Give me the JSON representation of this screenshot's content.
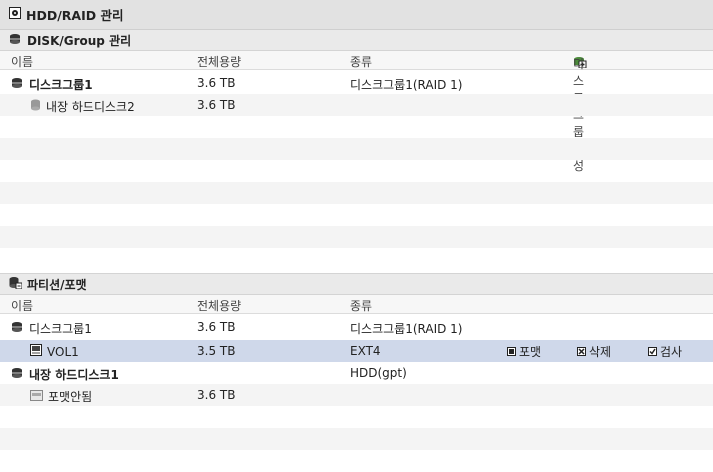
{
  "header": {
    "title": "HDD/RAID 관리"
  },
  "disk_section": {
    "title": "DISK/Group 관리",
    "columns": {
      "name": "이름",
      "total": "전체용량",
      "type": "종류"
    },
    "create_label": "디스크그룹 생성",
    "rows": [
      {
        "name": "디스크그룹1",
        "size": "3.6 TB",
        "type": "디스크그룹1(RAID 1)"
      },
      {
        "name": "내장 하드디스크2",
        "size": "3.6 TB",
        "type": ""
      }
    ]
  },
  "partition_section": {
    "title": "파티션/포맷",
    "columns": {
      "name": "이름",
      "total": "전체용량",
      "type": "종류"
    },
    "rows": [
      {
        "name": "디스크그룹1",
        "size": "3.6 TB",
        "type": "디스크그룹1(RAID 1)"
      },
      {
        "name": "VOL1",
        "size": "3.5 TB",
        "type": "EXT4"
      },
      {
        "name": "내장 하드디스크1",
        "size": "",
        "type": "HDD(gpt)"
      },
      {
        "name": "포맷안됨",
        "size": "3.6 TB",
        "type": ""
      }
    ],
    "actions": {
      "format": "포맷",
      "delete": "삭제",
      "check": "검사"
    }
  },
  "colors": {
    "selected_row": "#cfd8ea",
    "alt_row": "#f4f4f4",
    "header_bg": "#e2e2e2"
  }
}
